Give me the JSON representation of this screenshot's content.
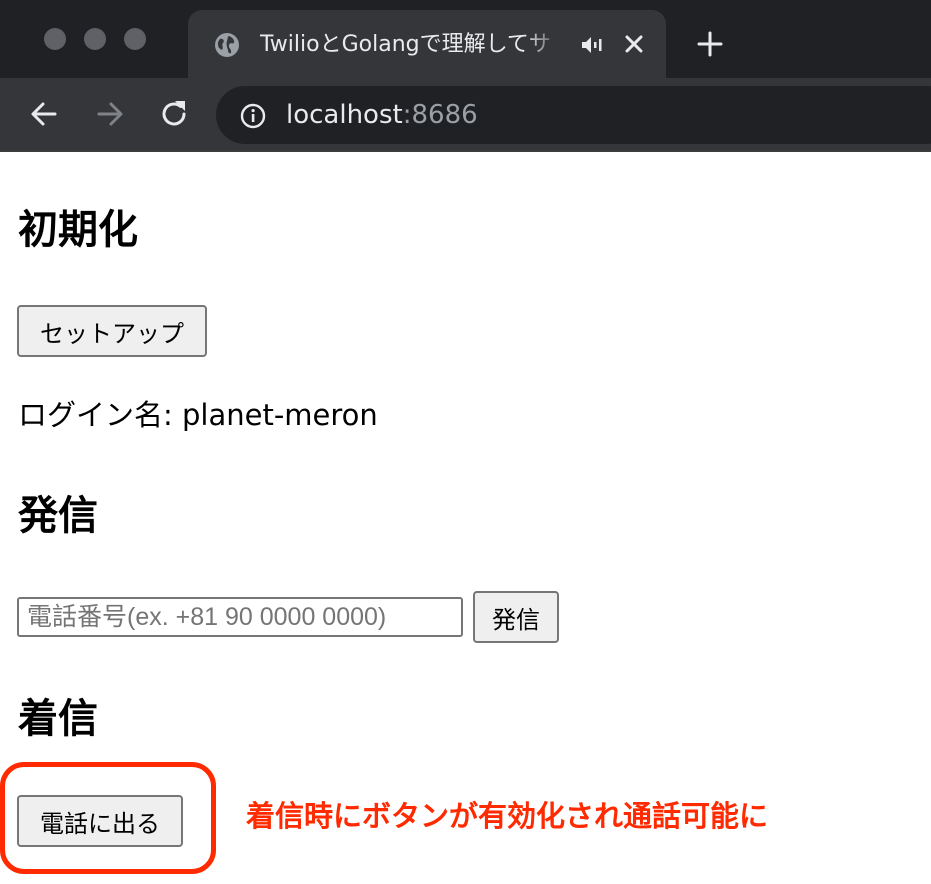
{
  "browser": {
    "tab_title": "TwilioとGolangで理解してサ",
    "url_host": "localhost",
    "url_port": ":8686",
    "icons": {
      "tab": "globe-icon",
      "audio": "speaker-icon",
      "close": "close-icon",
      "new_tab": "plus-icon",
      "back": "back-arrow-icon",
      "forward": "forward-arrow-icon",
      "reload": "reload-icon",
      "site_info": "info-icon"
    }
  },
  "sections": {
    "init": {
      "heading": "初期化",
      "setup_button": "セットアップ",
      "login_label": "ログイン名: planet-meron"
    },
    "outgoing": {
      "heading": "発信",
      "phone_placeholder": "電話番号(ex. +81 90 0000 0000)",
      "phone_value": "",
      "call_button": "発信"
    },
    "incoming": {
      "heading": "着信",
      "answer_button": "電話に出る"
    }
  },
  "annotation": {
    "text": "着信時にボタンが有効化され通話可能に",
    "color": "#ff2a00"
  }
}
